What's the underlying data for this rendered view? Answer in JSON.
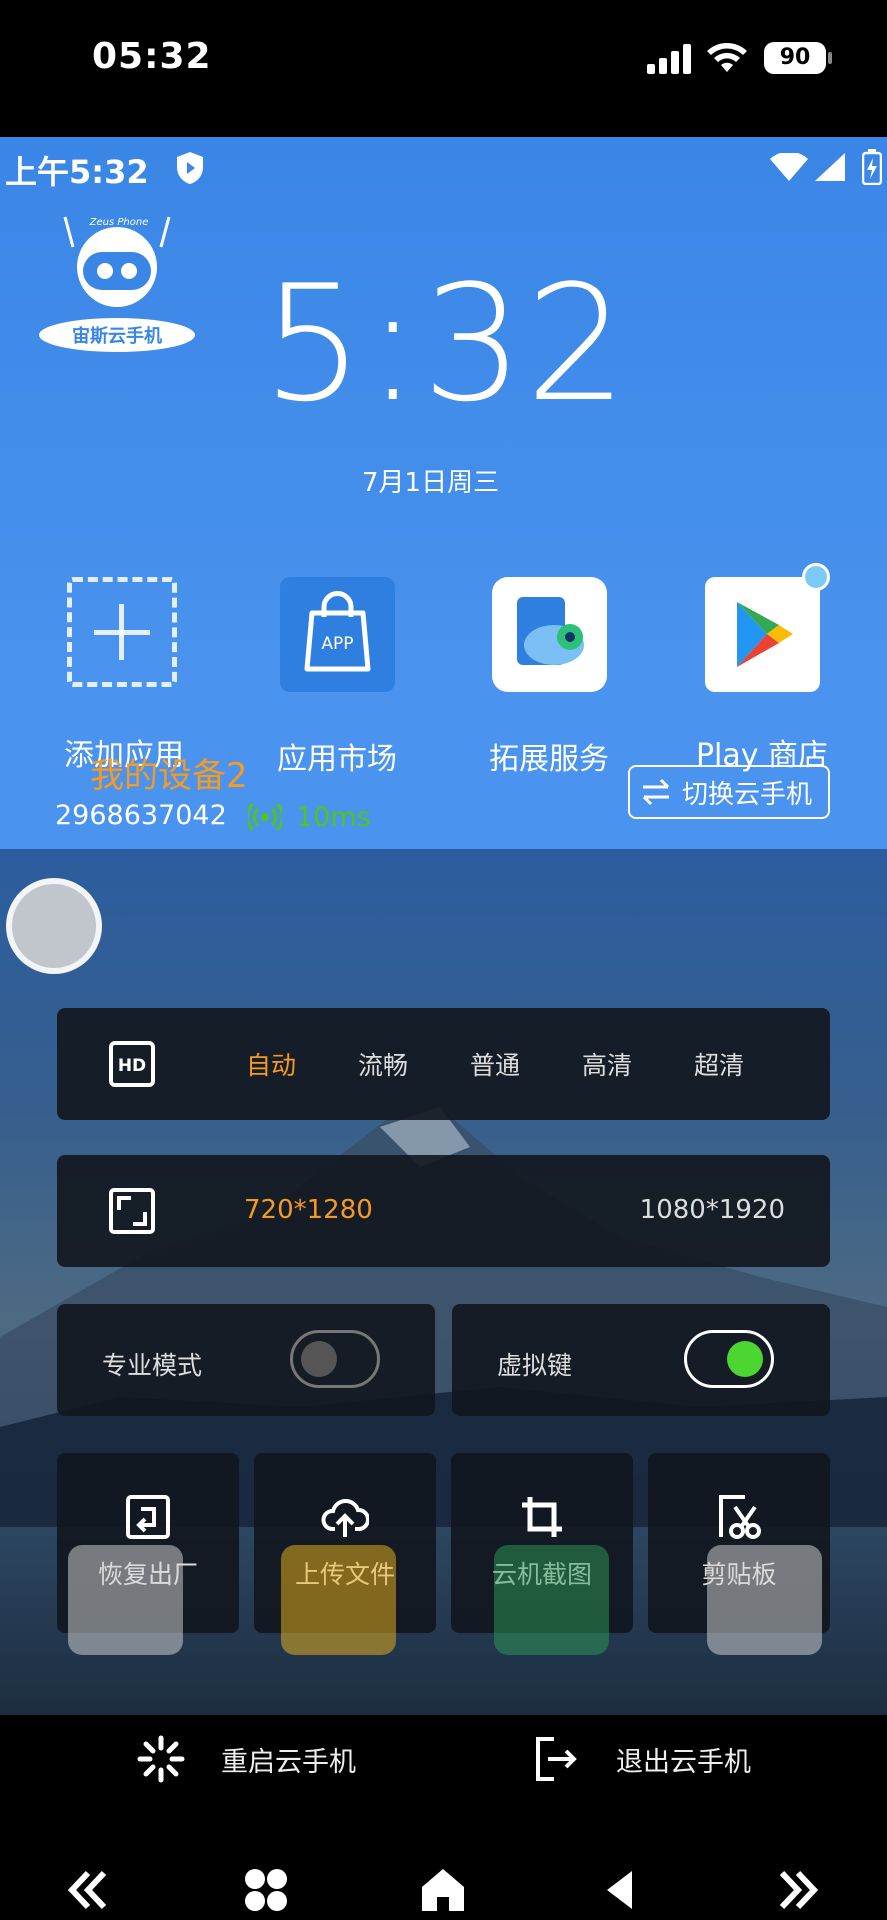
{
  "host_status": {
    "time": "05:32",
    "battery": "90"
  },
  "cloud_status": {
    "time": "上午5:32"
  },
  "logo": {
    "name": "宙斯云手机",
    "sub": "Zeus Phone"
  },
  "clock": {
    "time": "5:32",
    "date": "7月1日周三"
  },
  "apps": [
    {
      "label": "添加应用",
      "icon": "add-icon"
    },
    {
      "label": "应用市场",
      "icon": "app-market-icon",
      "icon_text": "APP"
    },
    {
      "label": "拓展服务",
      "icon": "extension-icon"
    },
    {
      "label": "Play 商店",
      "icon": "play-store-icon"
    }
  ],
  "device": {
    "name": "我的设备2",
    "id": "2968637042",
    "latency": "10ms",
    "switch_label": "切换云手机"
  },
  "quality": {
    "options": [
      "自动",
      "流畅",
      "普通",
      "高清",
      "超清"
    ],
    "selected": "自动"
  },
  "resolution": {
    "options": [
      "720*1280",
      "1080*1920"
    ],
    "selected": "720*1280"
  },
  "toggles": [
    {
      "label": "专业模式",
      "on": false
    },
    {
      "label": "虚拟键",
      "on": true
    }
  ],
  "tools": [
    {
      "label": "恢复出厂",
      "icon": "factory-reset-icon"
    },
    {
      "label": "上传文件",
      "icon": "upload-icon"
    },
    {
      "label": "云机截图",
      "icon": "crop-icon"
    },
    {
      "label": "剪贴板",
      "icon": "clipboard-icon"
    }
  ],
  "bottom_actions": [
    {
      "label": "重启云手机",
      "icon": "restart-icon"
    },
    {
      "label": "退出云手机",
      "icon": "exit-icon"
    }
  ],
  "colors": {
    "accent": "#f59a23",
    "latency": "#52c41a",
    "toggle_on": "#4cd631",
    "cloud_bg": "#4a93ee"
  }
}
